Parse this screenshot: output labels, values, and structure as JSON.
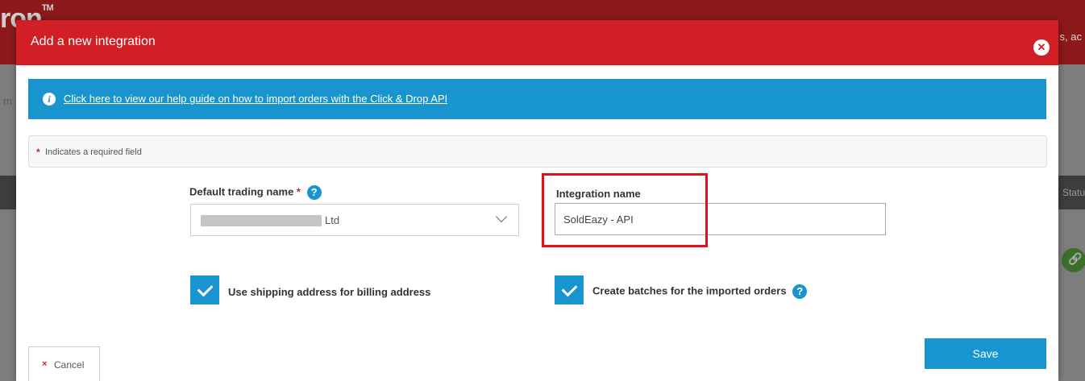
{
  "background": {
    "logo_text": "ron",
    "logo_tm": "TM",
    "topright_text": "s, ac",
    "status_col_fragment": "Statu",
    "left_fragment": "m"
  },
  "modal": {
    "title": "Add a new integration",
    "close_icon": "close-icon",
    "info": {
      "icon": "info-icon",
      "link_text": "Click here to view our help guide on how to import orders with the Click & Drop API"
    },
    "required_note": {
      "star": "*",
      "text": "Indicates a required field"
    },
    "trading_name": {
      "label": "Default trading name",
      "required_star": "*",
      "help_icon": "?",
      "selected_value": "Ltd"
    },
    "integration_name": {
      "label": "Integration name",
      "value": "SoldEazy - API"
    },
    "checkboxes": {
      "billing": {
        "label": "Use shipping address for billing address",
        "checked": true
      },
      "batches": {
        "label": "Create batches for the imported orders",
        "checked": true,
        "help_icon": "?"
      }
    },
    "cancel": {
      "icon": "×",
      "label": "Cancel"
    },
    "save": {
      "label": "Save"
    }
  },
  "colors": {
    "header_red": "#d21f26",
    "info_blue": "#1895cf",
    "highlight_red": "#e3101c"
  }
}
